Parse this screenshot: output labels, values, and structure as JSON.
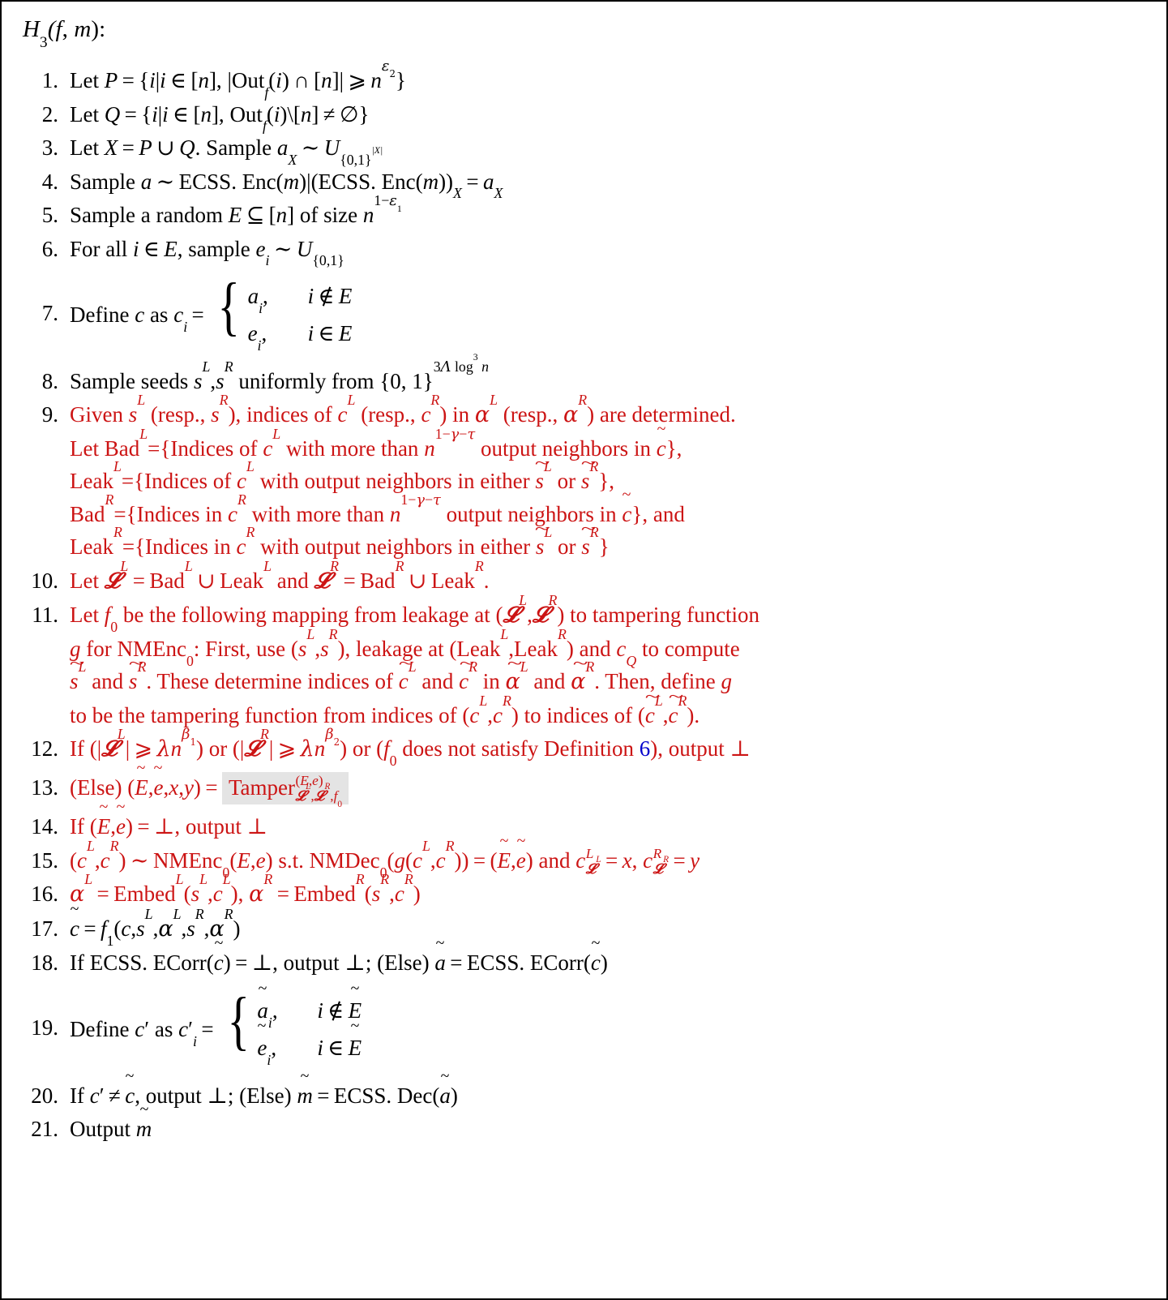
{
  "figure": {
    "kind": "algorithm-pseudocode-box",
    "title_plain": "H_3(f, m):",
    "text_color": "#000000",
    "highlight_color": "#CC1414",
    "link_color": "#0000CC",
    "highlight_box_color": "#E4E4E4"
  },
  "title": {
    "name": "H",
    "subscript": "3",
    "args": "(f, m)",
    "colon": ":"
  },
  "steps": [
    {
      "number": "1.",
      "color": "black",
      "text": "Let P = {i|i ∈ [n], |Out_f(i) ∩ [n]| ⩾ n^{ε2}}"
    },
    {
      "number": "2.",
      "color": "black",
      "text": "Let Q = {i|i ∈ [n], Out_f(i)\\[n] ≠ ∅}"
    },
    {
      "number": "3.",
      "color": "black",
      "text": "Let X = P ∪ Q. Sample a_X ∼ U_{{0,1}^{|X|}}"
    },
    {
      "number": "4.",
      "color": "black",
      "text": "Sample a ∼ ECSS. Enc(m)|(ECSS. Enc(m))_X = a_X"
    },
    {
      "number": "5.",
      "color": "black",
      "text": "Sample a random E ⊆ [n] of size n^{1−ε1}"
    },
    {
      "number": "6.",
      "color": "black",
      "text": "For all i ∈ E, sample e_i ∼ U_{{0,1}}"
    },
    {
      "number": "7.",
      "color": "black",
      "kind": "cases",
      "lead": "Define c as c_i =",
      "cases": [
        {
          "value": "a_i,",
          "condition": "i ∉ E"
        },
        {
          "value": "e_i,",
          "condition": "i ∈ E"
        }
      ]
    },
    {
      "number": "8.",
      "color": "black",
      "text": "Sample seeds s^L, s^R uniformly from {0,1}^{3Λ log^3 n}"
    },
    {
      "number": "9.",
      "color": "red",
      "lines": [
        "Given s^L (resp., s^R), indices of c^L (resp., c^R) in α^L (resp., α^R) are determined.",
        "Let Bad^L={Indices of c^L with more than n^{1−γ−τ} output neighbors in c̃},",
        "Leak^L={Indices of c^L with output neighbors in either s̃^L or s̃^R},",
        "Bad^R={Indices in c^R with more than n^{1−γ−τ} output neighbors in c̃}, and",
        "Leak^R={Indices in c^R with output neighbors in either s̃^L or s̃^R}"
      ]
    },
    {
      "number": "10.",
      "color": "red",
      "text": "Let 𝓛^L = Bad^L ∪ Leak^L and 𝓛^R = Bad^R ∪ Leak^R."
    },
    {
      "number": "11.",
      "color": "red",
      "lines": [
        "Let f_0 be the following mapping from leakage at (𝓛^L, 𝓛^R) to tampering function",
        "g for NMEnc_0: First, use (s^L, s^R), leakage at (Leak^L, Leak^R) and c_Q to compute",
        "s̃^L and s̃^R. These determine indices of c̃^L and c̃^R in α̃^L and α̃^R. Then, define g",
        "to be the tampering function from indices of (c^L, c^R) to indices of (c̃^L, c̃^R)."
      ]
    },
    {
      "number": "12.",
      "color": "red",
      "text": "If (|𝓛^L| ⩾ λn^{β1}) or (|𝓛^R| ⩾ λn^{β2}) or (f_0 does not satisfy Definition 6), output ⊥",
      "link_text": "6"
    },
    {
      "number": "13.",
      "color": "red",
      "text": "(Else) (Ẽ, ẽ, x, y) = Tamper^{(E,e)}_{𝓛^L,𝓛^R,f_0}",
      "highlighted_part": "Tamper^{(E,e)}_{𝓛^L,𝓛^R,f_0}"
    },
    {
      "number": "14.",
      "color": "red",
      "text": "If (Ẽ, ẽ) = ⊥, output ⊥"
    },
    {
      "number": "15.",
      "color": "red",
      "text": "(c^L, c^R) ∼ NMEnc_0(E, e) s.t. NMDec_0(g(c^L, c^R)) = (Ẽ, ẽ) and c^L_{𝓛^L} = x, c^R_{𝓛^R} = y"
    },
    {
      "number": "16.",
      "color": "red",
      "text": "α^L = Embed^L(s^L, c^L), α^R = Embed^R(s^R, c^R)"
    },
    {
      "number": "17.",
      "color": "black",
      "text": "c̃ = f_1(c, s^L, α^L, s^R, α^R)"
    },
    {
      "number": "18.",
      "color": "black",
      "text": "If ECSS. ECorr(c̃) = ⊥, output ⊥; (Else) ã = ECSS. ECorr(c̃)"
    },
    {
      "number": "19.",
      "color": "black",
      "kind": "cases",
      "lead": "Define c′ as c′_i =",
      "cases": [
        {
          "value": "ã_i,",
          "condition": "i ∉ Ẽ"
        },
        {
          "value": "ẽ_i,",
          "condition": "i ∈ Ẽ"
        }
      ]
    },
    {
      "number": "20.",
      "color": "black",
      "text": "If c′ ≠ c̃, output ⊥; (Else) m̃ = ECSS. Dec(ã)"
    },
    {
      "number": "21.",
      "color": "black",
      "text": "Output m̃"
    }
  ]
}
